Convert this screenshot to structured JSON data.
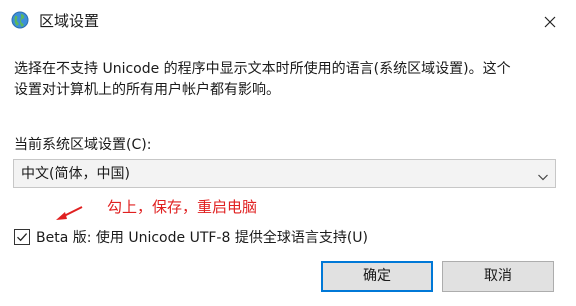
{
  "window": {
    "title": "区域设置",
    "app_icon": "globe-icon",
    "close_icon": "close-icon"
  },
  "description": {
    "line1": "选择在不支持 Unicode 的程序中显示文本时所使用的语言(系统区域设置)。这个",
    "line2": "设置对计算机上的所有用户帐户都有影响。"
  },
  "locale": {
    "label": "当前系统区域设置(C):",
    "selected": "中文(简体，中国)",
    "dropdown_icon": "chevron-down-icon"
  },
  "annotation": {
    "text": "勾上，保存，重启电脑",
    "color": "#e02020"
  },
  "beta_option": {
    "label": "Beta 版: 使用 Unicode UTF-8 提供全球语言支持(U)",
    "checked": true
  },
  "buttons": {
    "ok": "确定",
    "cancel": "取消"
  },
  "colors": {
    "accent": "#0078d7",
    "button_bg": "#e1e1e1"
  }
}
